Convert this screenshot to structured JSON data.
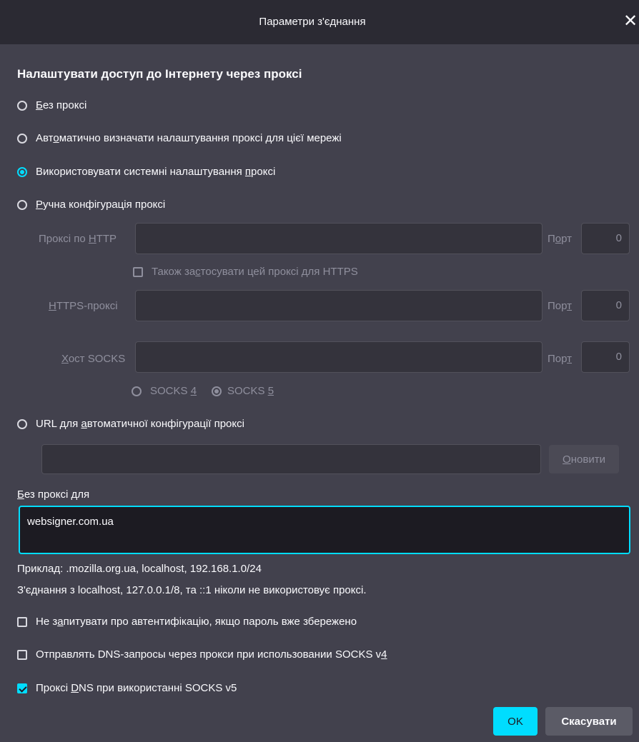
{
  "dialog": {
    "title": "Параметри з'єднання",
    "close_glyph": "✕"
  },
  "proxy": {
    "heading": "Налаштувати доступ до Інтернету через проксі",
    "options": [
      {
        "pre": "",
        "u": "Б",
        "post": "ез проксі",
        "checked": false
      },
      {
        "pre": "Авт",
        "u": "о",
        "post": "матично визначати налаштування проксі для цієї мережі",
        "checked": false
      },
      {
        "pre": "Використовувати системні налаштування ",
        "u": "п",
        "post": "роксі",
        "checked": true
      },
      {
        "pre": "",
        "u": "Р",
        "post": "учна конфігурація проксі",
        "checked": false
      }
    ],
    "http_label_pre": "Проксі по ",
    "http_label_u": "Н",
    "http_label_post": "TTP",
    "http_value": "",
    "port_label_1_pre": "П",
    "port_label_1_u": "о",
    "port_label_1_post": "рт",
    "http_port": "0",
    "also_https_pre": "Також за",
    "also_https_u": "с",
    "also_https_post": "тосувати цей проксі для HTTPS",
    "https_label_pre": "",
    "https_label_u": "H",
    "https_label_post": "TTPS-проксі",
    "https_value": "",
    "port_label_2_pre": "Пор",
    "port_label_2_u": "т",
    "port_label_2_post": "",
    "https_port": "0",
    "socks_label_pre": "",
    "socks_label_u": "Х",
    "socks_label_post": "ост SOCKS",
    "socks_value": "",
    "port_label_3_pre": "Пор",
    "port_label_3_u": "т",
    "port_label_3_post": "",
    "socks_port": "0",
    "socks4_pre": "SOCKS ",
    "socks4_u": "4",
    "socks5_pre": "SOCKS ",
    "socks5_u": "5",
    "autoconfig_pre": "URL для ",
    "autoconfig_u": "а",
    "autoconfig_post": "втоматичної конфігурації проксі",
    "autoconfig_value": "",
    "refresh_u": "О",
    "refresh_post": "новити"
  },
  "no_proxy": {
    "label_u": "Б",
    "label_post": "ез проксі для",
    "value": "websigner.com.ua",
    "example": "Приклад: .mozilla.org.ua, localhost, 192.168.1.0/24",
    "note": "З'єднання з localhost, 127.0.0.1/8, та ::1 ніколи не використовує проксі."
  },
  "options": {
    "no_auth_pre": "Не з",
    "no_auth_u": "а",
    "no_auth_post": "питувати про автентифікацію, якщо пароль вже збережено",
    "dns_v4_pre": "Отправлять DNS-запросы через прокси при использовании SOCKS v",
    "dns_v4_u": "4",
    "dns_v5_pre": "Проксі ",
    "dns_v5_u": "D",
    "dns_v5_post": "NS при використанні SOCKS v5"
  },
  "buttons": {
    "ok": "OK",
    "cancel": "Скасувати"
  },
  "colors": {
    "accent": "#00ddff",
    "background": "#42414d",
    "titlebar": "#2b2a33"
  }
}
